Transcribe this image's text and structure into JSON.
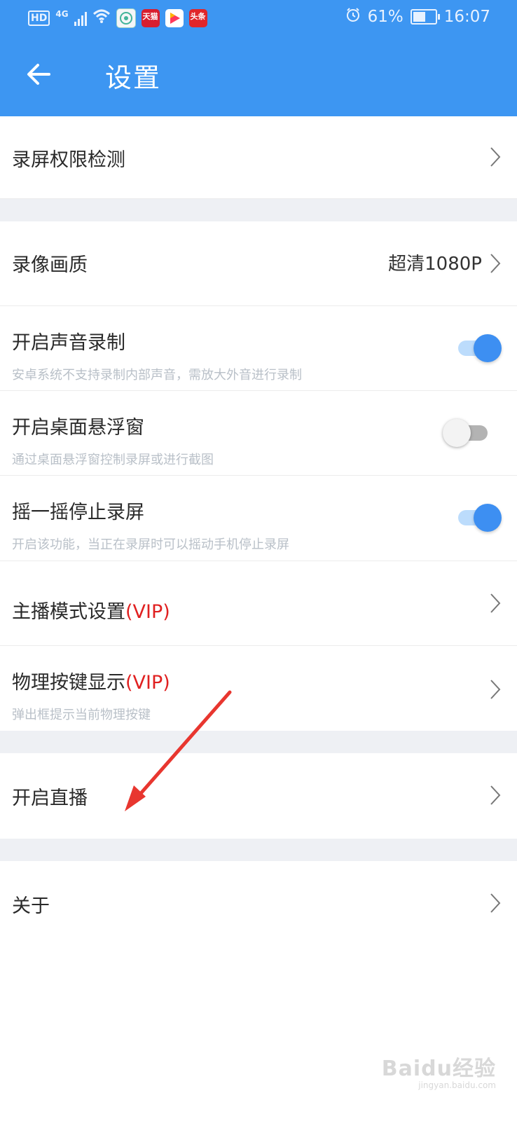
{
  "status_bar": {
    "left_badge": "HD",
    "network": "4G",
    "app_icons": [
      {
        "name": "app-icon-1",
        "label": "",
        "color": "#ffffff"
      },
      {
        "name": "app-icon-tianmao",
        "label": "天猫",
        "color": "#d81e2f"
      },
      {
        "name": "app-icon-video",
        "label": "▶",
        "color": "#ff3a5c"
      },
      {
        "name": "app-icon-toutiao",
        "label": "头条",
        "color": "#e0262a"
      }
    ],
    "battery": "61%",
    "time": "16:07"
  },
  "header": {
    "title": "设置",
    "back_icon": "arrow-left-icon",
    "color": "#3d96f2"
  },
  "settings": {
    "permission_check": {
      "label": "录屏权限检测"
    },
    "video_quality": {
      "label": "录像画质",
      "value": "超清1080P"
    },
    "audio_record": {
      "label": "开启声音录制",
      "sub": "安卓系统不支持录制内部声音，需放大外音进行录制",
      "enabled": true
    },
    "floating_window": {
      "label": "开启桌面悬浮窗",
      "sub": "通过桌面悬浮窗控制录屏或进行截图",
      "enabled": false
    },
    "shake_stop": {
      "label": "摇一摇停止录屏",
      "sub": "开启该功能，当正在录屏时可以摇动手机停止录屏",
      "enabled": true
    },
    "anchor_mode": {
      "label": "主播模式设置",
      "vip": "(VIP)"
    },
    "physical_keys": {
      "label": "物理按键显示",
      "vip": "(VIP)",
      "sub": "弹出框提示当前物理按键"
    },
    "live": {
      "label": "开启直播"
    },
    "about": {
      "label": "关于"
    }
  },
  "annotation": {
    "color": "#e8362f"
  },
  "watermark": {
    "main": "Baidu经验",
    "sub": "jingyan.baidu.com"
  }
}
